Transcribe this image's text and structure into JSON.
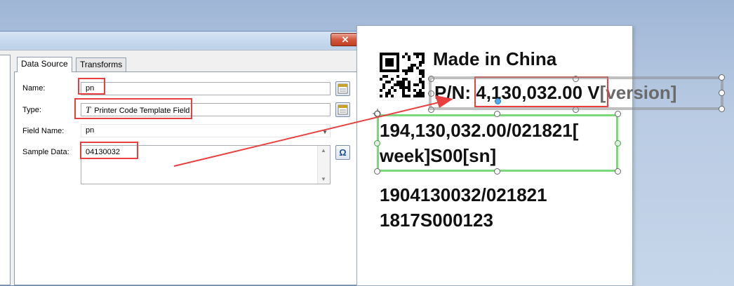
{
  "dialog": {
    "close_label": "✕",
    "tabs": [
      {
        "label": "Data Source"
      },
      {
        "label": "Transforms"
      }
    ],
    "fields": {
      "name": {
        "label": "Name:",
        "value": "pn"
      },
      "type": {
        "label": "Type:",
        "value": "Printer Code Template Field",
        "icon": "T"
      },
      "field_name": {
        "label": "Field Name:",
        "value": "pn"
      },
      "sample_data": {
        "label": "Sample Data:",
        "value": "04130032"
      }
    },
    "omega_label": "Ω"
  },
  "label": {
    "made_in": "Made in China",
    "pn_prefix": "P/N:",
    "pn_value": "4,130,032.00",
    "pn_suffix": "V",
    "version_field": "[version]",
    "line1": "194,130,032.00/021821[",
    "line2": "week]S00[sn]",
    "line3": "1904130032/021821",
    "line4": "1817S000123"
  },
  "colors": {
    "annotation_red": "#e84040",
    "selection_green": "#7bd87b",
    "selection_gray": "#9a9a9a"
  }
}
